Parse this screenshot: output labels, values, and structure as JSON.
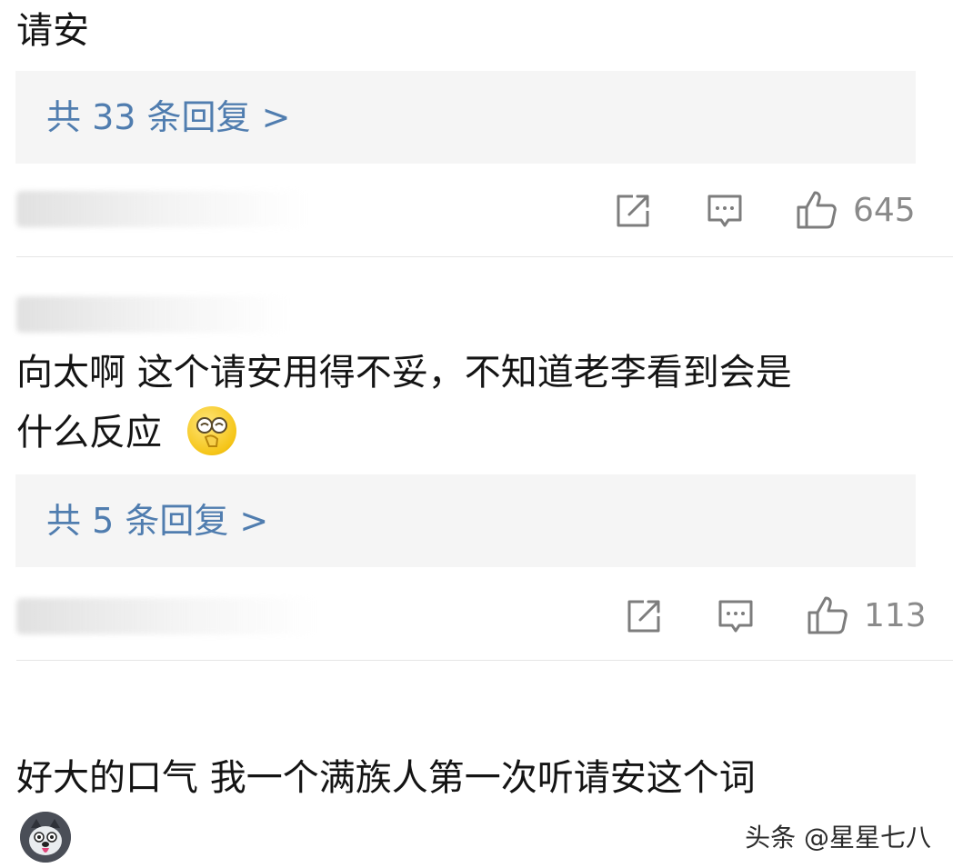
{
  "comments": [
    {
      "text_lines": [
        "请安"
      ],
      "reply_link": "共 33 条回复 >",
      "likes": "645"
    },
    {
      "text_lines": [
        "向太啊 这个请安用得不妥，不知道老李看到会是",
        "什么反应"
      ],
      "emoji": "covering-face-emoji",
      "reply_link": "共 5 条回复 >",
      "likes": "113"
    },
    {
      "text_lines": [
        "好大的口气 我一个满族人第一次听请安这个词"
      ]
    }
  ],
  "icons": {
    "share": "share-icon",
    "comment": "comment-icon",
    "like": "thumbs-up-icon"
  },
  "colors": {
    "link": "#507daf",
    "reply_bg": "#f5f5f5",
    "meta_gray": "#8a8a8a"
  },
  "watermark": "头条 @星星七八"
}
